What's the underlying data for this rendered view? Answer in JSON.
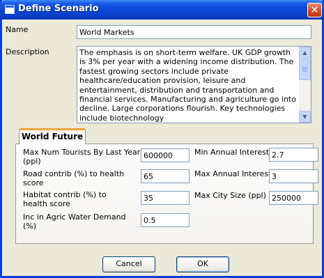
{
  "window": {
    "title": "Define Scenario",
    "close_glyph": "✕"
  },
  "name": {
    "label": "Name",
    "value": "World Markets"
  },
  "description": {
    "label": "Description",
    "text": "The emphasis is on short-term welfare. UK  GDP growth is 3% per year with a widening income distribution. The fastest growing sectors include private healthcare/education provision, leisure and entertainment, distribution and transportation and financial services. Manufacturing and agriculture go into decline. Large corporations flourish. Key technologies include biotechnology",
    "scroll_up_glyph": "▲",
    "scroll_down_glyph": "▼"
  },
  "tab": {
    "label": "World Future"
  },
  "params": {
    "tourists": {
      "label": "Max Num Tourists By Last Year (ppl)",
      "value": "600000"
    },
    "road": {
      "label": "Road contrib (%) to health score",
      "value": "65"
    },
    "habitat": {
      "label": "Habitat contrib (%) to health score",
      "value": "35"
    },
    "agric": {
      "label": "Inc in Agric Water Demand (%)",
      "value": "0.5"
    },
    "min_interest": {
      "label": "Min Annual Interest",
      "value": "2.7"
    },
    "max_interest": {
      "label": "Max Annual Interest",
      "value": "3"
    },
    "max_city": {
      "label": "Max City Size (ppl)",
      "value": "250000"
    }
  },
  "buttons": {
    "cancel": "Cancel",
    "ok": "OK"
  },
  "icons": {
    "title_icon": "window-icon",
    "close_icon": "close-icon"
  }
}
